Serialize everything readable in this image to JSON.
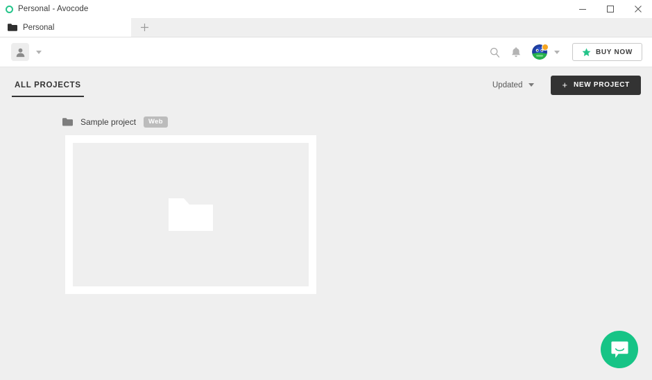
{
  "window": {
    "title": "Personal - Avocode",
    "app_icon": "avocode-ring-icon",
    "accent_green": "#24c48a",
    "controls": {
      "minimize": "minimize-icon",
      "maximize": "maximize-icon",
      "close": "close-icon"
    }
  },
  "tabstrip": {
    "tabs": [
      {
        "label": "Personal",
        "icon": "folder-icon",
        "active": true
      }
    ],
    "new_tab_label": "+"
  },
  "toolbar": {
    "account_switcher": {
      "icon": "user-avatar-placeholder-icon",
      "caret": "chevron-down-icon"
    },
    "search_icon": "search-icon",
    "notifications_icon": "bell-icon",
    "user_avatar": {
      "icon": "user-avatar-icon",
      "badge": "notification-dot",
      "badge_color": "#f5a623",
      "caret": "chevron-down-icon"
    },
    "buy_now": {
      "label": "BUY NOW",
      "icon": "star-icon",
      "icon_color": "#24c48a"
    }
  },
  "subheader": {
    "tab_label": "ALL PROJECTS",
    "sort": {
      "label": "Updated",
      "caret": "chevron-down-icon"
    },
    "new_project": {
      "label": "NEW PROJECT",
      "plus": "+",
      "background": "#333333"
    }
  },
  "content": {
    "projects": [
      {
        "name": "Sample project",
        "icon": "folder-icon",
        "badge": "Web",
        "card": {
          "placeholder_icon": "folder-placeholder-icon",
          "empty": true
        }
      }
    ]
  },
  "chat": {
    "icon": "chat-bubble-smile-icon",
    "color": "#16c486"
  }
}
